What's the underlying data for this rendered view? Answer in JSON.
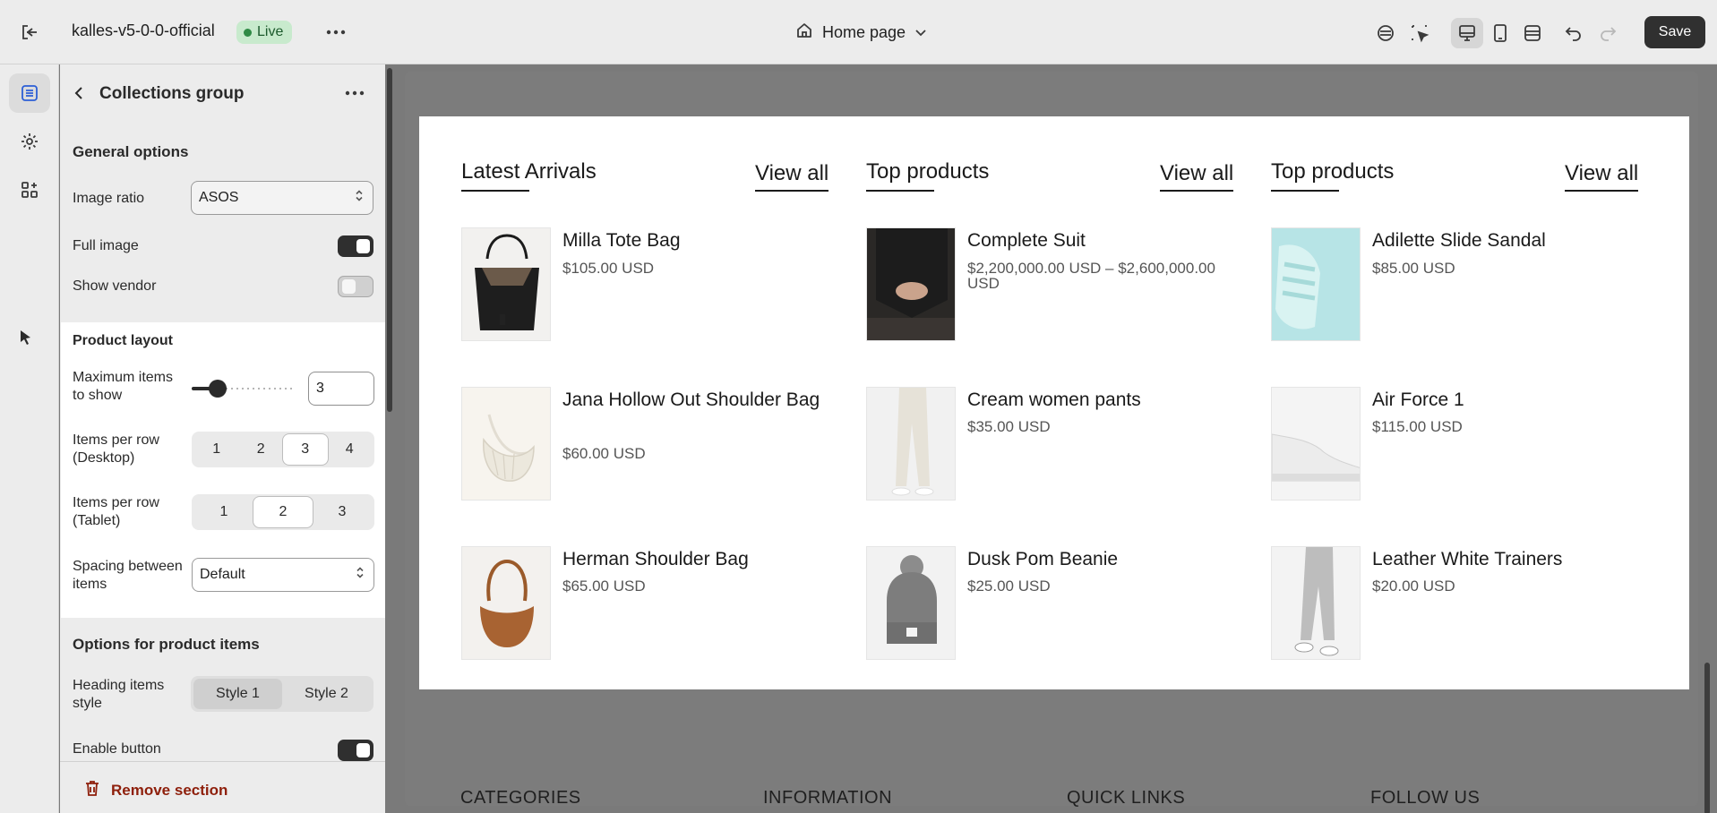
{
  "topbar": {
    "store_name": "kalles-v5-0-0-official",
    "live_badge": "Live",
    "page_selector": "Home page",
    "save_label": "Save"
  },
  "panel": {
    "title": "Collections group",
    "general_heading": "General options",
    "image_ratio_label": "Image ratio",
    "image_ratio_value": "ASOS",
    "full_image_label": "Full image",
    "full_image_on": true,
    "show_vendor_label": "Show vendor",
    "show_vendor_on": false,
    "product_layout_heading": "Product layout",
    "max_items_label": "Maximum items to show",
    "max_items_value": "3",
    "per_row_desktop_label": "Items per row (Desktop)",
    "per_row_desktop_options": [
      "1",
      "2",
      "3",
      "4"
    ],
    "per_row_desktop_selected": "3",
    "per_row_tablet_label": "Items per row (Tablet)",
    "per_row_tablet_options": [
      "1",
      "2",
      "3"
    ],
    "per_row_tablet_selected": "2",
    "spacing_label": "Spacing between items",
    "spacing_value": "Default",
    "product_items_heading": "Options for product items",
    "heading_style_label": "Heading items style",
    "heading_style_options": [
      "Style 1",
      "Style 2"
    ],
    "heading_style_selected": "Style 1",
    "enable_button_label": "Enable button",
    "enable_button_on": true,
    "remove_section": "Remove section"
  },
  "preview": {
    "columns": [
      {
        "title": "Latest Arrivals",
        "view_all": "View all",
        "products": [
          {
            "name": "Milla Tote Bag",
            "price": "$105.00 USD",
            "image": "black-tote-bag"
          },
          {
            "name": "Jana Hollow Out Shoulder Bag",
            "price": "$60.00 USD",
            "image": "white-shoulder-bag"
          },
          {
            "name": "Herman Shoulder Bag",
            "price": "$65.00 USD",
            "image": "brown-shoulder-bag"
          }
        ]
      },
      {
        "title": "Top products",
        "view_all": "View all",
        "products": [
          {
            "name": "Complete Suit",
            "price": "$2,200,000.00 USD – $2,600,000.00 USD",
            "image": "black-suit"
          },
          {
            "name": "Cream women pants",
            "price": "$35.00 USD",
            "image": "cream-pants"
          },
          {
            "name": "Dusk Pom Beanie",
            "price": "$25.00 USD",
            "image": "grey-beanie"
          }
        ]
      },
      {
        "title": "Top products",
        "view_all": "View all",
        "products": [
          {
            "name": "Adilette Slide Sandal",
            "price": "$85.00 USD",
            "image": "mint-sandals"
          },
          {
            "name": "Air Force 1",
            "price": "$115.00 USD",
            "image": "white-sneaker"
          },
          {
            "name": "Leather White Trainers",
            "price": "$20.00 USD",
            "image": "grey-joggers-trainers"
          }
        ]
      }
    ],
    "footer_headings": [
      "CATEGORIES",
      "INFORMATION",
      "QUICK LINKS",
      "FOLLOW US"
    ]
  },
  "colors": {
    "accent_dark": "#303030",
    "live_badge_bg": "#c8eacd",
    "danger": "#8e1f0b"
  },
  "icons": [
    "exit-icon",
    "more-icon",
    "home-icon",
    "chevron-down-icon",
    "inspector-icon",
    "select-icon",
    "desktop-icon",
    "mobile-icon",
    "fullwidth-icon",
    "undo-icon",
    "redo-icon",
    "sections-icon",
    "settings-icon",
    "apps-icon",
    "back-icon",
    "trash-icon"
  ]
}
